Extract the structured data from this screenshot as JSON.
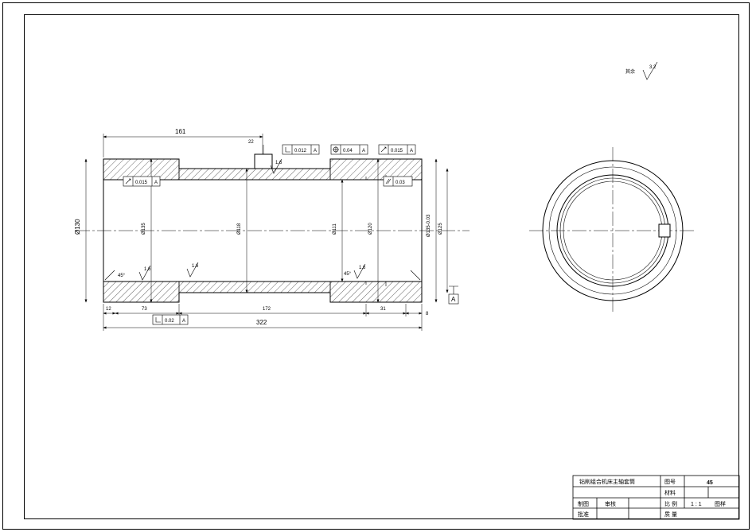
{
  "surface_note": "其余",
  "surface_value": "3.2",
  "dims": {
    "len_161": "161",
    "len_322": "322",
    "len_12": "12",
    "len_73": "73",
    "len_172": "172",
    "len_31": "31",
    "len_8": "8",
    "dia_130": "Ø130",
    "dia_135": "Ø135",
    "dia_120": "Ø120",
    "dia_118": "Ø118",
    "dia_111": "Ø111",
    "dia_125": "Ø125",
    "dia_135_m7": "Ø135-0.03"
  },
  "gdt": {
    "runout_0015_1": "0.015",
    "runout_0015_2": "0.015",
    "perp_002": "0.02",
    "perp_0012": "0.012",
    "pos_004": "0.04",
    "cyl_003": "0.03",
    "datum_a": "A",
    "datum": "A"
  },
  "chamfer": {
    "c45_1": "45°",
    "c45_2": "45°"
  },
  "sf": {
    "ra16_1": "1.6",
    "ra16_2": "1.6",
    "ra16_3": "1.6",
    "ra16_4": "1.6"
  },
  "titleblock": {
    "part_name": "钻削组合机床主轴套筒",
    "material_l": "材料",
    "material": "45",
    "scale_l": "比 例",
    "scale": "1 : 1",
    "mass_l": "质 量",
    "sheet_l": "图样",
    "design_l": "制图",
    "proof_l": "审核",
    "approve_l": "批准",
    "draw_no": "图号"
  }
}
